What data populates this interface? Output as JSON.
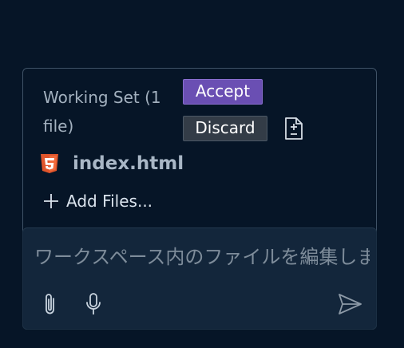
{
  "working_set": {
    "title": "Working Set (1 file)",
    "accept_label": "Accept",
    "discard_label": "Discard",
    "diff_icon": "file-diff-icon",
    "files": [
      {
        "name": "index.html",
        "icon": "html5-icon"
      }
    ],
    "add_files_label": "Add Files...",
    "add_icon": "plus-icon"
  },
  "chat_input": {
    "placeholder": "ワークスペース内のファイルを編集します"
  },
  "toolbar": {
    "attach_icon": "paperclip-icon",
    "mic_icon": "microphone-icon",
    "send_icon": "send-icon"
  },
  "colors": {
    "background": "#061527",
    "panel_border": "#3f5266",
    "accept": "#6a4fb3",
    "discard": "#333c47",
    "html5": "#e0552b",
    "input_bg": "#13263b"
  }
}
